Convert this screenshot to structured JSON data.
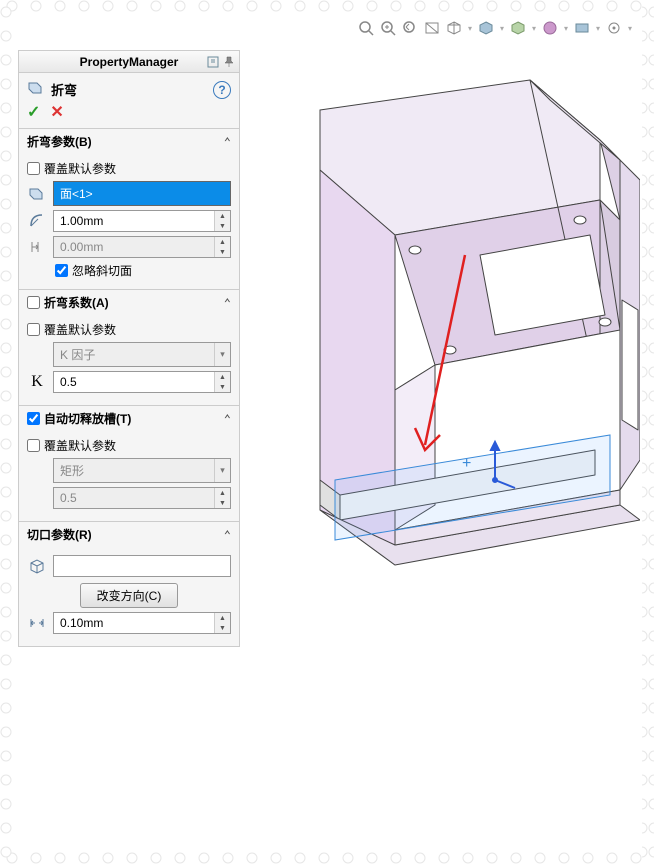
{
  "header": {
    "title": "PropertyManager"
  },
  "feature": {
    "title": "折弯",
    "help": "?"
  },
  "sections": {
    "bend_params": {
      "title": "折弯参数(B)",
      "override_default": "覆盖默认参数",
      "face_selection": "面<1>",
      "radius": "1.00mm",
      "offset": "0.00mm",
      "ignore_bevel": "忽略斜切面"
    },
    "bend_factor": {
      "title": "折弯系数(A)",
      "override_default": "覆盖默认参数",
      "factor_type": "K 因子",
      "factor_value": "0.5",
      "k_label": "K"
    },
    "auto_relief": {
      "title": "自动切释放槽(T)",
      "override_default": "覆盖默认参数",
      "relief_type": "矩形",
      "relief_ratio": "0.5"
    },
    "cut_params": {
      "title": "切口参数(R)",
      "change_dir": "改变方向(C)",
      "gap": "0.10mm"
    }
  }
}
